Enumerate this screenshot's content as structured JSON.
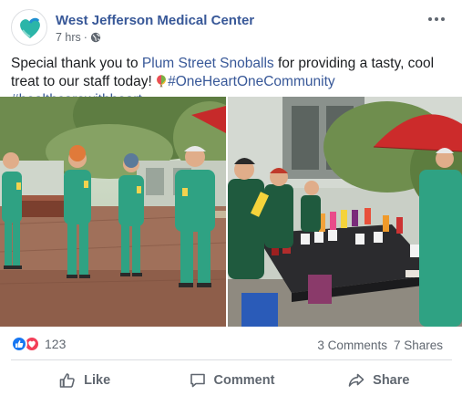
{
  "post": {
    "page_name": "West Jefferson Medical Center",
    "time": "7 hrs",
    "separator": "·",
    "text_part1": "Special thank you to ",
    "mention": "Plum Street Snoballs",
    "text_part2": " for providing a tasty, cool treat to our staff today! ",
    "hashtag1": "#OneHeartOneCommunity",
    "hashtag2": "#healthcarewithheart",
    "icons": {
      "avatar": "heart-logo-icon",
      "privacy": "globe-icon",
      "menu": "more-icon",
      "emoji": "balloon-icon"
    }
  },
  "stats": {
    "reaction_count": "123",
    "comments": "3 Comments",
    "shares": "7 Shares"
  },
  "actions": {
    "like": "Like",
    "comment": "Comment",
    "share": "Share"
  },
  "colors": {
    "link": "#385898",
    "like": "#1877f2",
    "love": "#f33e58",
    "muted": "#606770",
    "scrubs": "#2fa283"
  }
}
